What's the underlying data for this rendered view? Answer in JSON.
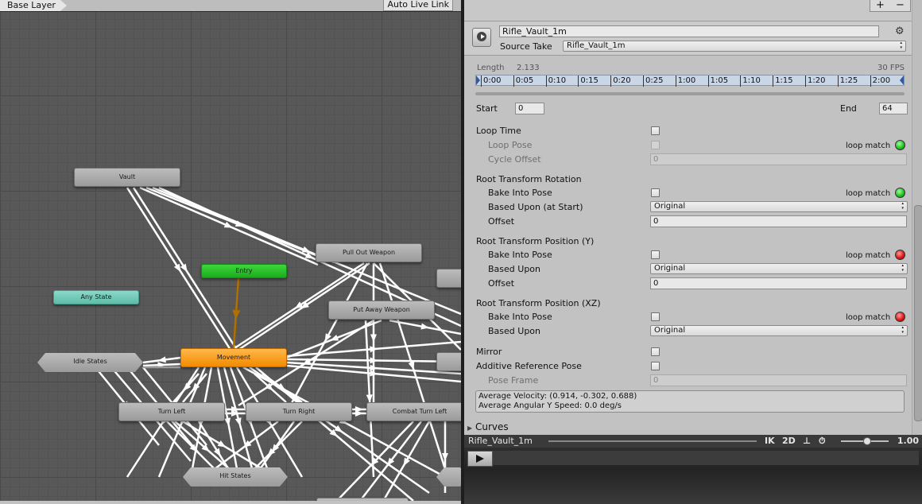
{
  "graph": {
    "layer_name": "Base Layer",
    "live_link_label": "Auto Live Link",
    "states": {
      "vault": "Vault",
      "entry": "Entry",
      "any_state": "Any State",
      "pull_out_weapon": "Pull Out Weapon",
      "put_away_weapon": "Put Away Weapon",
      "idle_states": "Idle States",
      "movement": "Movement",
      "turn_left": "Turn Left",
      "turn_right": "Turn Right",
      "combat_turn_left": "Combat Turn Left",
      "hit_states": "Hit States"
    },
    "colors": {
      "entry": "#22c022",
      "any_state": "#6cc4b2",
      "movement": "#f59a10",
      "default": "#a8a8a8"
    }
  },
  "inspector": {
    "toolbar": {
      "plus": "+",
      "minus": "−"
    },
    "clip_name": "Rifle_Vault_1m",
    "source_take_label": "Source Take",
    "source_take_value": "Rifle_Vault_1m",
    "length_label": "Length",
    "length_value": "2.133",
    "fps_label": "30 FPS",
    "timeline_ticks": [
      "0:00",
      "0:05",
      "0:10",
      "0:15",
      "0:20",
      "0:25",
      "1:00",
      "1:05",
      "1:10",
      "1:15",
      "1:20",
      "1:25",
      "2:00"
    ],
    "start_label": "Start",
    "start_value": "0",
    "end_label": "End",
    "end_value": "64",
    "loop_time": "Loop Time",
    "loop_pose": "Loop Pose",
    "loop_match": "loop match",
    "cycle_offset": "Cycle Offset",
    "cycle_offset_value": "0",
    "root_rotation": "Root Transform Rotation",
    "bake_into_pose": "Bake Into Pose",
    "based_upon_start": "Based Upon (at Start)",
    "based_upon": "Based Upon",
    "offset": "Offset",
    "original": "Original",
    "rotation_offset_value": "0",
    "root_position_y": "Root Transform Position (Y)",
    "position_y_offset_value": "0",
    "root_position_xz": "Root Transform Position (XZ)",
    "mirror": "Mirror",
    "additive_ref_pose": "Additive Reference Pose",
    "pose_frame": "Pose Frame",
    "pose_frame_value": "0",
    "avg_velocity": "Average Velocity: (0.914, -0.302, 0.688)",
    "avg_angular": "Average Angular Y Speed: 0.0 deg/s",
    "curves": "Curves",
    "loop_match_status": {
      "loop_pose": "green",
      "rotation": "green",
      "position_y": "red",
      "position_xz": "red"
    }
  },
  "preview": {
    "title": "Rifle_Vault_1m",
    "ik": "IK",
    "mode_2d": "2D",
    "speed": "1.00"
  }
}
